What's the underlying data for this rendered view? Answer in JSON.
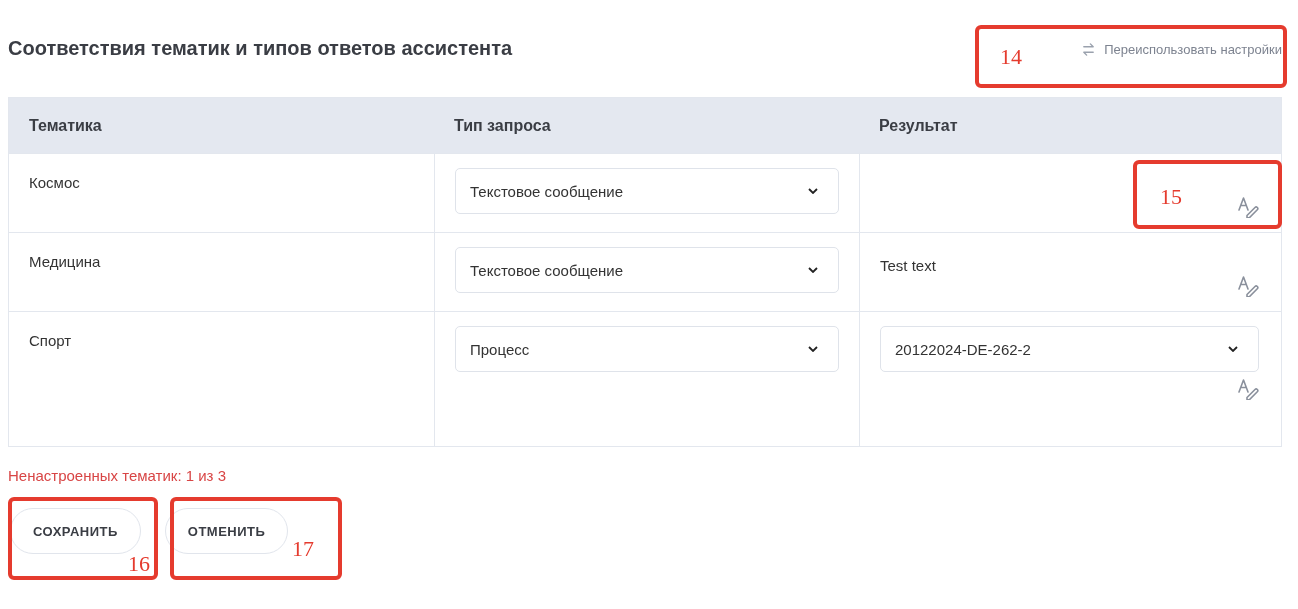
{
  "title": "Соответствия тематик и типов ответов ассистента",
  "reuse_link": "Переиспользовать настройки",
  "table": {
    "columns": [
      "Тематика",
      "Тип запроса",
      "Результат"
    ],
    "rows": [
      {
        "topic": "Космос",
        "request_type": "Текстовое сообщение",
        "result": {
          "kind": "empty"
        }
      },
      {
        "topic": "Медицина",
        "request_type": "Текстовое сообщение",
        "result": {
          "kind": "text",
          "value": "Test text"
        }
      },
      {
        "topic": "Спорт",
        "request_type": "Процесс",
        "result": {
          "kind": "select",
          "value": "20122024-DE-262-2"
        }
      }
    ]
  },
  "unconfigured_note": "Ненастроенных тематик: 1 из 3",
  "buttons": [
    "СОХРАНИТЬ",
    "ОТМЕНИТЬ"
  ],
  "annotations": [
    "14",
    "15",
    "16",
    "17"
  ]
}
